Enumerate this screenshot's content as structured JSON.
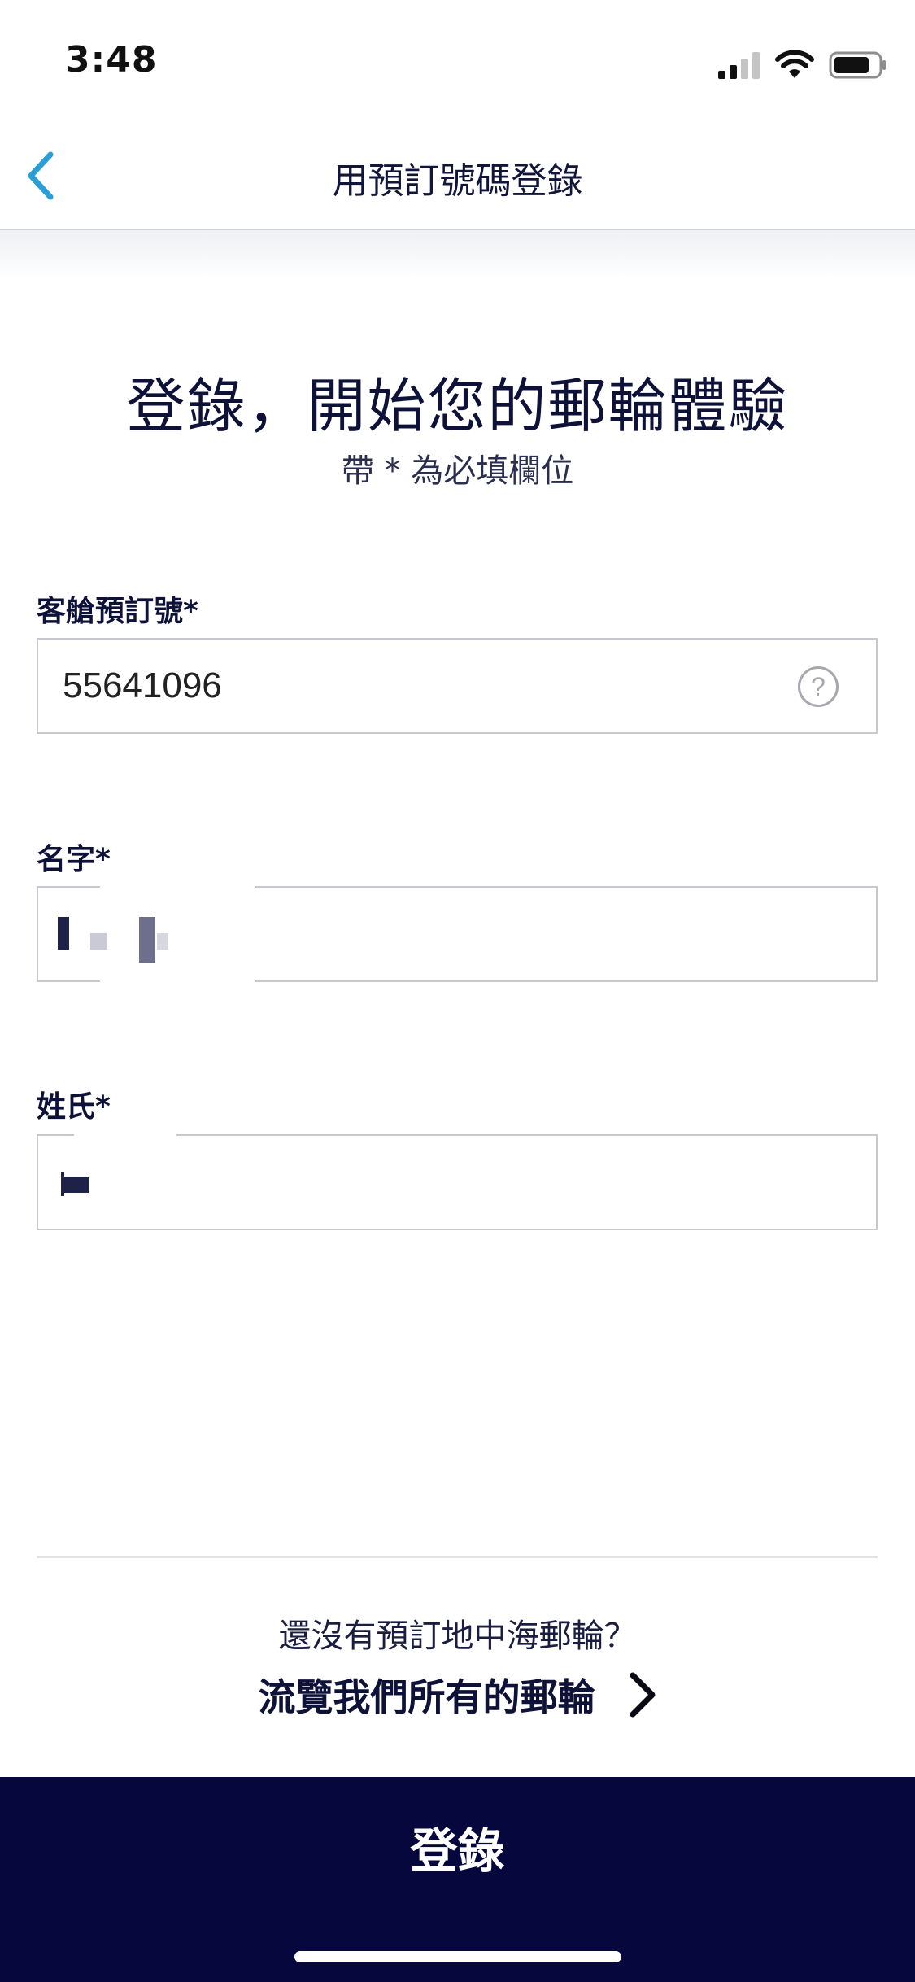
{
  "status_bar": {
    "time": "3:48"
  },
  "nav": {
    "back_icon": "chevron-left-icon",
    "title": "用預訂號碼登錄",
    "accent_color": "#2a9fd6"
  },
  "hero": {
    "title": "登錄，開始您的郵輪體驗",
    "subtitle": "帶 * 為必填欄位"
  },
  "form": {
    "booking_number": {
      "label": "客艙預訂號*",
      "value": "55641096",
      "help_icon": "question-circle-icon"
    },
    "first_name": {
      "label": "名字*",
      "value": ""
    },
    "last_name": {
      "label": "姓氏*",
      "value": ""
    }
  },
  "footer": {
    "question": "還沒有預訂地中海郵輪？",
    "link_label": "流覽我們所有的郵輪",
    "link_icon": "chevron-right-icon"
  },
  "login_button": {
    "label": "登錄",
    "background": "#05073d"
  }
}
